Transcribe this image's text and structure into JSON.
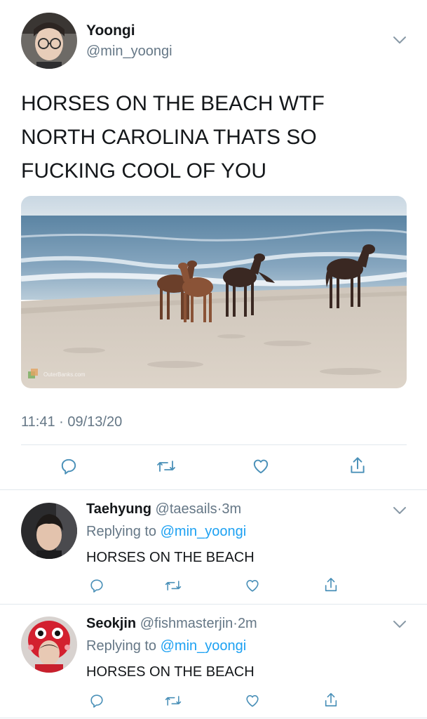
{
  "main_tweet": {
    "author_name": "Yoongi",
    "author_handle": "@min_yoongi",
    "text_lines": [
      "HORSES ON THE BEACH WTF",
      "NORTH CAROLINA THATS SO",
      "FUCKING COOL OF YOU"
    ],
    "media_watermark": "OuterBanks.com",
    "timestamp": "11:41 · 09/13/20",
    "actions": [
      "reply-icon",
      "retweet-icon",
      "like-icon",
      "share-icon"
    ]
  },
  "replies": [
    {
      "author_name": "Taehyung",
      "author_handle": "@taesails",
      "time": "3m",
      "replying_prefix": "Replying to",
      "replying_to": "@min_yoongi",
      "text": "HORSES ON THE BEACH"
    },
    {
      "author_name": "Seokjin",
      "author_handle": "@fishmasterjin",
      "time": "2m",
      "replying_prefix": "Replying to",
      "replying_to": "@min_yoongi",
      "text": "HORSES ON THE BEACH"
    }
  ],
  "colors": {
    "link": "#1da1f2",
    "muted": "#657786",
    "divider": "#e1e8ed",
    "text": "#14171a"
  }
}
